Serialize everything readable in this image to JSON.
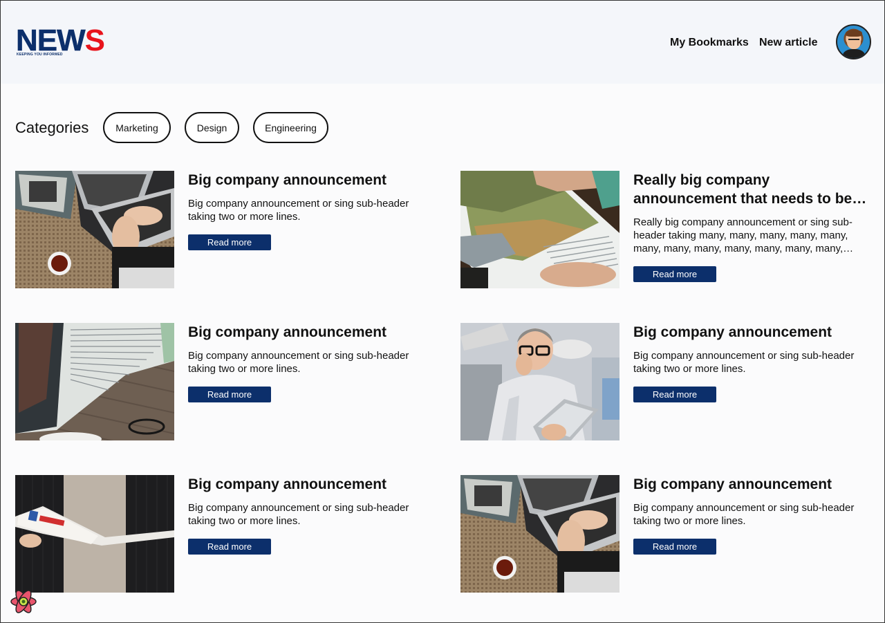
{
  "header": {
    "logo": {
      "main": "NEW",
      "accent": "S",
      "tagline": "KEEPING YOU INFORMED"
    },
    "nav": [
      {
        "label": "My Bookmarks"
      },
      {
        "label": "New article"
      }
    ],
    "avatar_icon": "user-avatar-icon"
  },
  "categories": {
    "title": "Categories",
    "chips": [
      {
        "label": "Marketing"
      },
      {
        "label": "Design"
      },
      {
        "label": "Engineering"
      }
    ]
  },
  "articles": [
    {
      "title": "Big company announcement",
      "description": "Big company announcement or sing sub-header taking two or more lines.",
      "button": "Read more",
      "image": "laptop-typing-image"
    },
    {
      "title": "Really big company announcement that needs to be…",
      "description": "Really big company announcement or sing sub-header taking many, many, many, many, many, many, many, many, many, many, many, many,…",
      "button": "Read more",
      "image": "magazine-landscape-image"
    },
    {
      "title": "Big company announcement",
      "description": "Big company announcement or sing sub-header taking two or more lines.",
      "button": "Read more",
      "image": "open-magazine-glasses-image"
    },
    {
      "title": "Big company announcement",
      "description": "Big company announcement or sing sub-header taking two or more lines.",
      "button": "Read more",
      "image": "man-with-tablet-image"
    },
    {
      "title": "Big company announcement",
      "description": "Big company announcement or sing sub-header taking two or more lines.",
      "button": "Read more",
      "image": "person-holding-magazine-image"
    },
    {
      "title": "Big company announcement",
      "description": "Big company announcement or sing sub-header taking two or more lines.",
      "button": "Read more",
      "image": "laptop-typing-image"
    }
  ],
  "colors": {
    "brand_blue": "#0c2f6b",
    "brand_red": "#e8141c",
    "header_bg": "#f4f6fa",
    "page_bg": "#fbfbfc"
  }
}
